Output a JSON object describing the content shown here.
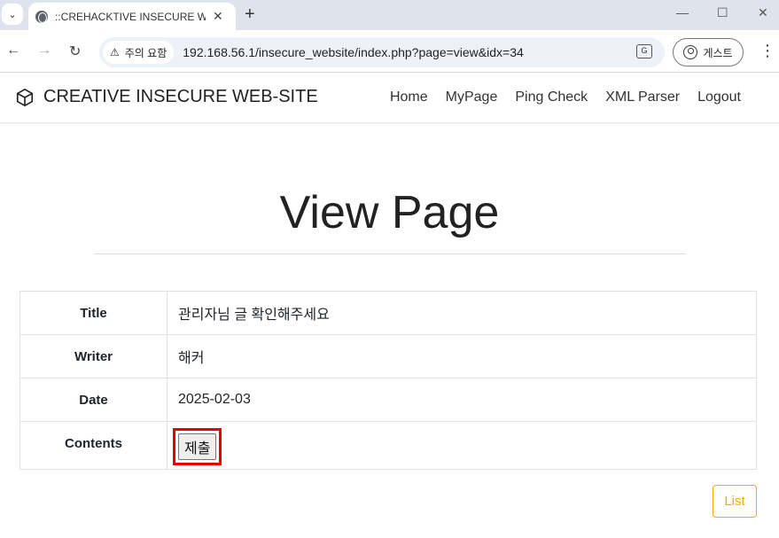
{
  "browser": {
    "tab_title": "::CREHACKTIVE INSECURE WEB",
    "security_label": "주의 요함",
    "url": "192.168.56.1/insecure_website/index.php?page=view&idx=34",
    "profile_label": "게스트"
  },
  "site": {
    "brand": "CREATIVE INSECURE WEB-SITE",
    "nav": [
      "Home",
      "MyPage",
      "Ping Check",
      "XML Parser",
      "Logout"
    ]
  },
  "page": {
    "title": "View Page"
  },
  "post": {
    "title_label": "Title",
    "title_value": "관리자님 글 확인해주세요",
    "writer_label": "Writer",
    "writer_value": "해커",
    "date_label": "Date",
    "date_value": "2025-02-03",
    "contents_label": "Contents",
    "submit_label": "제출"
  },
  "actions": {
    "list_label": "List"
  },
  "colors": {
    "highlight": "#e60000",
    "list_button": "#f0ad00"
  }
}
